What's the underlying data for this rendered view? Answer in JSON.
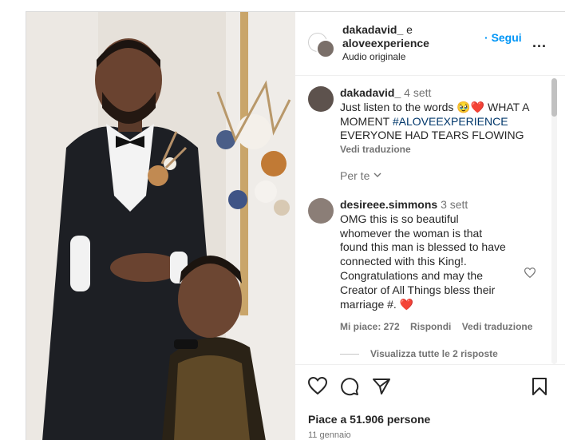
{
  "post_header": {
    "author": "dakadavid_",
    "conjunction": "e",
    "collaborator": "aloveexperience",
    "audio": "Audio originale",
    "follow_label": "Segui",
    "more_label": "..."
  },
  "caption": {
    "username": "dakadavid_",
    "time": "4 sett",
    "line1": "Just listen to the words 🥹❤️ WHAT A",
    "line2_prefix": "MOMENT",
    "hashtag": "#ALOVEEXPERIENCE",
    "line3": "EVERYONE HAD TEARS FLOWING",
    "translate": "Vedi traduzione"
  },
  "filter_label": "Per te",
  "comment": {
    "username": "desireee.simmons",
    "time": "3 sett",
    "lines": [
      "OMG this is so beautiful",
      "whomever the woman is that",
      "found this man is blessed to have",
      "connected with this King!.",
      "Congratulations and may the",
      "Creator of All Things bless their",
      "marriage #. ❤️"
    ],
    "likes": "Mi piace: 272",
    "reply": "Rispondi",
    "translate": "Vedi traduzione",
    "view_replies": "Visualizza tutte le 2 risposte"
  },
  "footer": {
    "likes": "Piace a 51.906 persone",
    "date": "11 gennaio"
  },
  "icons": {
    "like": "heart-icon",
    "comment": "comment-icon",
    "share": "paper-plane-icon",
    "save": "bookmark-icon"
  },
  "colors": {
    "follow": "#0095f6",
    "hashtag": "#00376b",
    "muted": "#737373"
  }
}
